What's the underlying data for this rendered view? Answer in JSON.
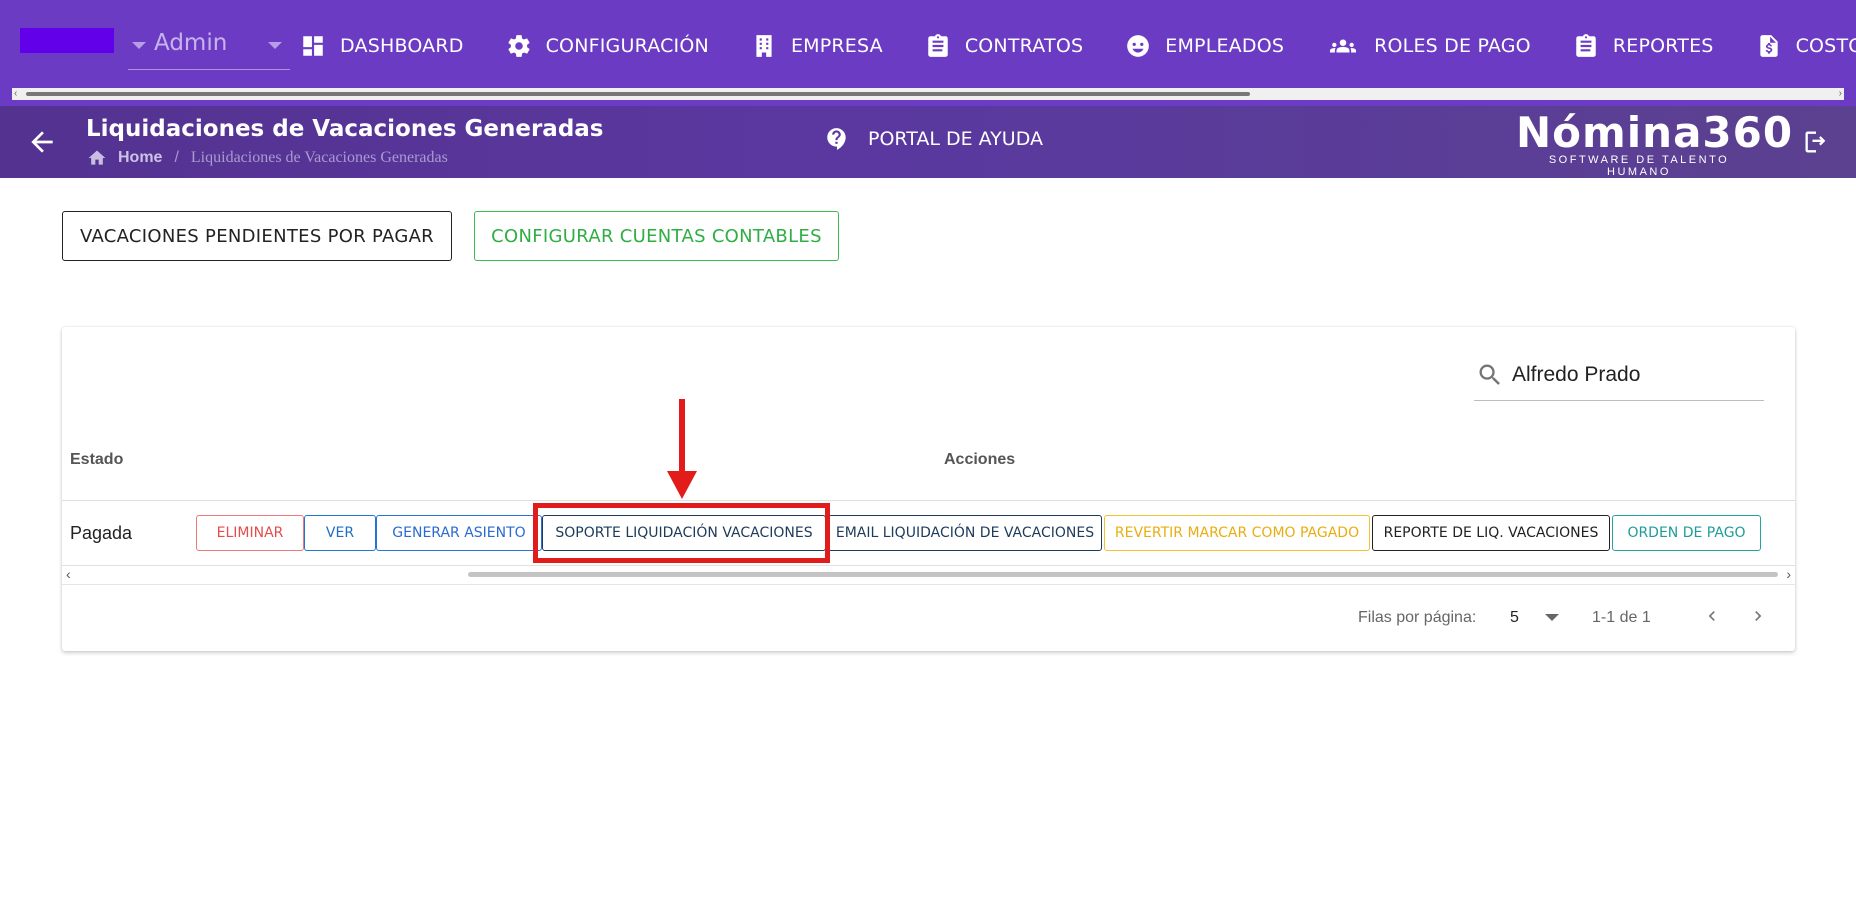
{
  "header": {
    "company_color": "#6200ea",
    "role_select": {
      "value": "Admin"
    },
    "nav": [
      {
        "label": "DASHBOARD",
        "icon": "dashboard-icon"
      },
      {
        "label": "CONFIGURACIÓN",
        "icon": "gear-icon"
      },
      {
        "label": "EMPRESA",
        "icon": "building-icon"
      },
      {
        "label": "CONTRATOS",
        "icon": "clipboard-icon"
      },
      {
        "label": "EMPLEADOS",
        "icon": "face-icon"
      },
      {
        "label": "ROLES DE PAGO",
        "icon": "people-icon"
      },
      {
        "label": "REPORTES",
        "icon": "clipboard-list-icon"
      },
      {
        "label": "COSTOS",
        "icon": "invoice-dollar-icon"
      }
    ]
  },
  "subheader": {
    "title": "Liquidaciones de Vacaciones Generadas",
    "breadcrumb": {
      "home": "Home",
      "separator": "/",
      "current": "Liquidaciones de Vacaciones Generadas"
    },
    "help_link": "PORTAL DE AYUDA",
    "brand": {
      "name": "Nómina360",
      "tagline": "SOFTWARE DE TALENTO HUMANO"
    }
  },
  "toolbar": {
    "pending_button": "VACACIONES PENDIENTES POR PAGAR",
    "accounts_button": "CONFIGURAR CUENTAS CONTABLES"
  },
  "table": {
    "search": {
      "value": "Alfredo Prado"
    },
    "headers": {
      "estado": "Estado",
      "acciones": "Acciones"
    },
    "rows": [
      {
        "estado": "Pagada",
        "actions": {
          "eliminar": "ELIMINAR",
          "ver": "VER",
          "generar_asiento": "GENERAR ASIENTO",
          "soporte": "SOPORTE LIQUIDACIÓN VACACIONES",
          "email": "EMAIL LIQUIDACIÓN DE VACACIONES",
          "revertir": "REVERTIR MARCAR COMO PAGADO",
          "reporte": "REPORTE DE LIQ. VACACIONES",
          "orden_pago": "ORDEN DE PAGO"
        }
      }
    ],
    "pagination": {
      "rows_per_page_label": "Filas por página:",
      "rows_per_page": "5",
      "range": "1-1 de 1"
    }
  },
  "colors": {
    "header": "#6c3bc3",
    "highlight": "#e21b1b"
  }
}
